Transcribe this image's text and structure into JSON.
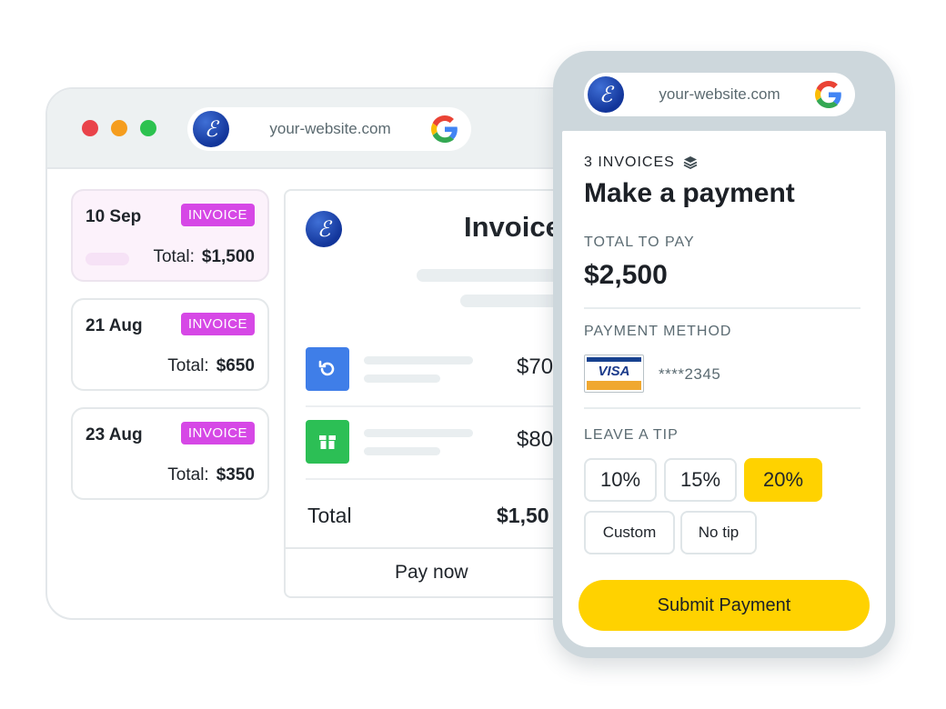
{
  "desktop": {
    "url": "your-website.com",
    "invoices": [
      {
        "date": "10 Sep",
        "badge": "INVOICE",
        "total_label": "Total:",
        "total": "$1,500"
      },
      {
        "date": "21 Aug",
        "badge": "INVOICE",
        "total_label": "Total:",
        "total": "$650"
      },
      {
        "date": "23 Aug",
        "badge": "INVOICE",
        "total_label": "Total:",
        "total": "$350"
      }
    ],
    "detail": {
      "logo_letter": "ℰ",
      "title": "Invoice",
      "items": [
        {
          "icon": "refresh-icon",
          "amount": "$70"
        },
        {
          "icon": "box-icon",
          "amount": "$80"
        }
      ],
      "total_label": "Total",
      "total": "$1,50",
      "pay_button": "Pay now"
    },
    "colors": {
      "badge": "#d648e6",
      "blue_icon": "#3f7ee8",
      "green_icon": "#2cbf55"
    }
  },
  "mobile": {
    "url": "your-website.com",
    "logo_letter": "ℰ",
    "invoice_count": "3 INVOICES",
    "title": "Make a payment",
    "total_label": "TOTAL TO PAY",
    "total": "$2,500",
    "payment_method_label": "PAYMENT METHOD",
    "card_brand": "VISA",
    "card_number": "****2345",
    "tip_label": "LEAVE A TIP",
    "tips": [
      "10%",
      "15%",
      "20%"
    ],
    "selected_tip": "20%",
    "tip_custom": "Custom",
    "tip_none": "No tip",
    "submit": "Submit Payment",
    "colors": {
      "accent": "#ffd200"
    }
  }
}
